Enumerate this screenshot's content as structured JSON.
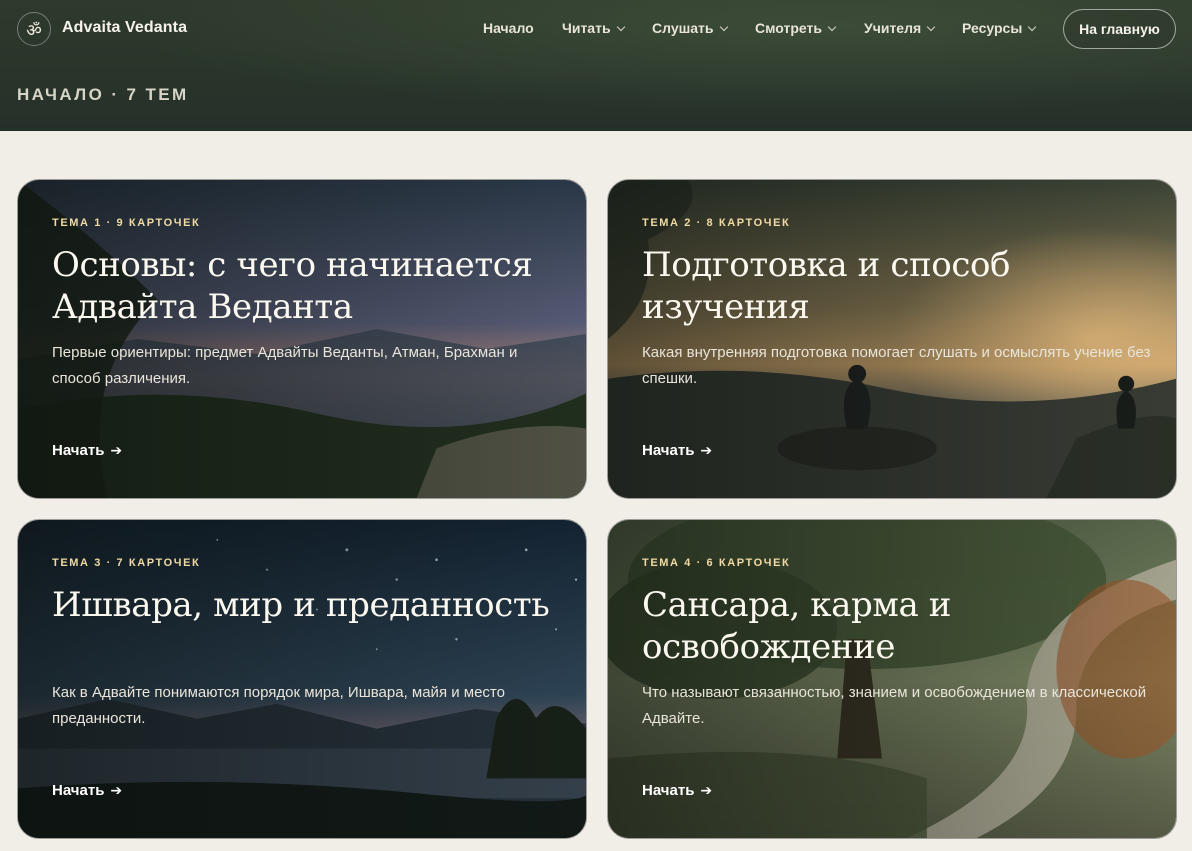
{
  "brand": {
    "logo_glyph": "ॐ",
    "name": "Advaita Vedanta"
  },
  "nav": {
    "items": [
      {
        "label": "Начало",
        "dropdown": false
      },
      {
        "label": "Читать",
        "dropdown": true
      },
      {
        "label": "Слушать",
        "dropdown": true
      },
      {
        "label": "Смотреть",
        "dropdown": true
      },
      {
        "label": "Учителя",
        "dropdown": true
      },
      {
        "label": "Ресурсы",
        "dropdown": true
      }
    ],
    "home_button": "На главную"
  },
  "breadcrumb": "НАЧАЛО · 7 ТЕМ",
  "cards": [
    {
      "meta": "ТЕМА 1 · 9 КАРТОЧЕК",
      "title": "Основы: с чего начинается Адвайта Веданта",
      "description": "Первые ориентиры: предмет Адвайты Веданты, Атман, Брахман и способ различения.",
      "cta": "Начать"
    },
    {
      "meta": "ТЕМА 2 · 8 КАРТОЧЕК",
      "title": "Подготовка и способ изучения",
      "description": "Какая внутренняя подготовка помогает слушать и осмыслять учение без спешки.",
      "cta": "Начать"
    },
    {
      "meta": "ТЕМА 3 · 7 КАРТОЧЕК",
      "title": "Ишвара, мир и преданность",
      "description": "Как в Адвайте понимаются порядок мира, Ишвара, майя и место преданности.",
      "cta": "Начать"
    },
    {
      "meta": "ТЕМА 4 · 6 КАРТОЧЕК",
      "title": "Сансара, карма и освобождение",
      "description": "Что называют связанностью, знанием и освобождением в классической Адвайте.",
      "cta": "Начать"
    }
  ],
  "icons": {
    "arrow": "arrow-right-icon",
    "chevron": "chevron-down-icon",
    "logo": "om-icon"
  },
  "colors": {
    "header_bg": "#29352a",
    "page_bg": "#f1eee8",
    "meta_accent": "#f0d9a2"
  }
}
